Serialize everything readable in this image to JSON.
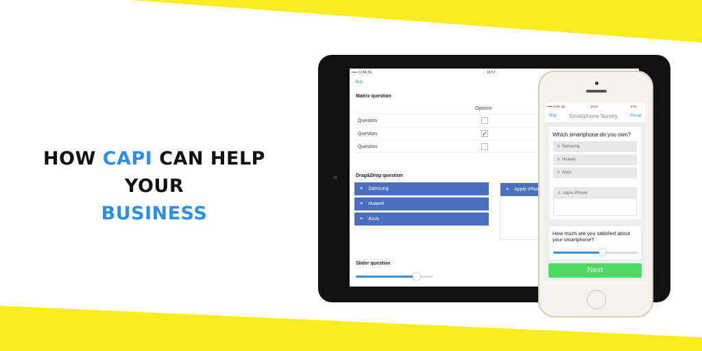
{
  "colors": {
    "yellow": "#f9ec1f",
    "accent": "#2e8fe8",
    "dragbar": "#4a6fbe",
    "next": "#4cd964"
  },
  "headline": {
    "line1_a": "HOW ",
    "line1_accent": "CAPI",
    "line1_b": " CAN HELP YOUR",
    "line2": "BUSINESS"
  },
  "tablet": {
    "status_carrier": "••••• 3 ITA  3G",
    "status_time": "16:57",
    "stop": "Stop",
    "matrix": {
      "title": "Matrix question",
      "column": "Options",
      "rows": [
        {
          "label": "Question",
          "checked": false
        },
        {
          "label": "Question",
          "checked": true
        },
        {
          "label": "Question",
          "checked": false
        }
      ]
    },
    "dragdrop": {
      "title": "Drag&Drop question",
      "items": [
        "Samsung",
        "Huawei",
        "Asus"
      ],
      "dropped": [
        "Apple iPhone"
      ]
    },
    "slider": {
      "title": "Slider question",
      "value_percent": 78
    }
  },
  "phone": {
    "status_carrier": "••••• 3 ITA  3G",
    "status_time": "16:57",
    "status_battery": "57%",
    "stop": "Stop",
    "title": "Smartphone Survey",
    "recap": "Recap",
    "q1": {
      "title": "Which smartphone do you own?",
      "items": [
        "Samsung",
        "Huawei",
        "Asus"
      ],
      "dropped": [
        "Apple iPhone"
      ]
    },
    "q2": {
      "title": "How much are you satisfied about your smartphone?",
      "value_percent": 58
    },
    "next": "Next"
  }
}
